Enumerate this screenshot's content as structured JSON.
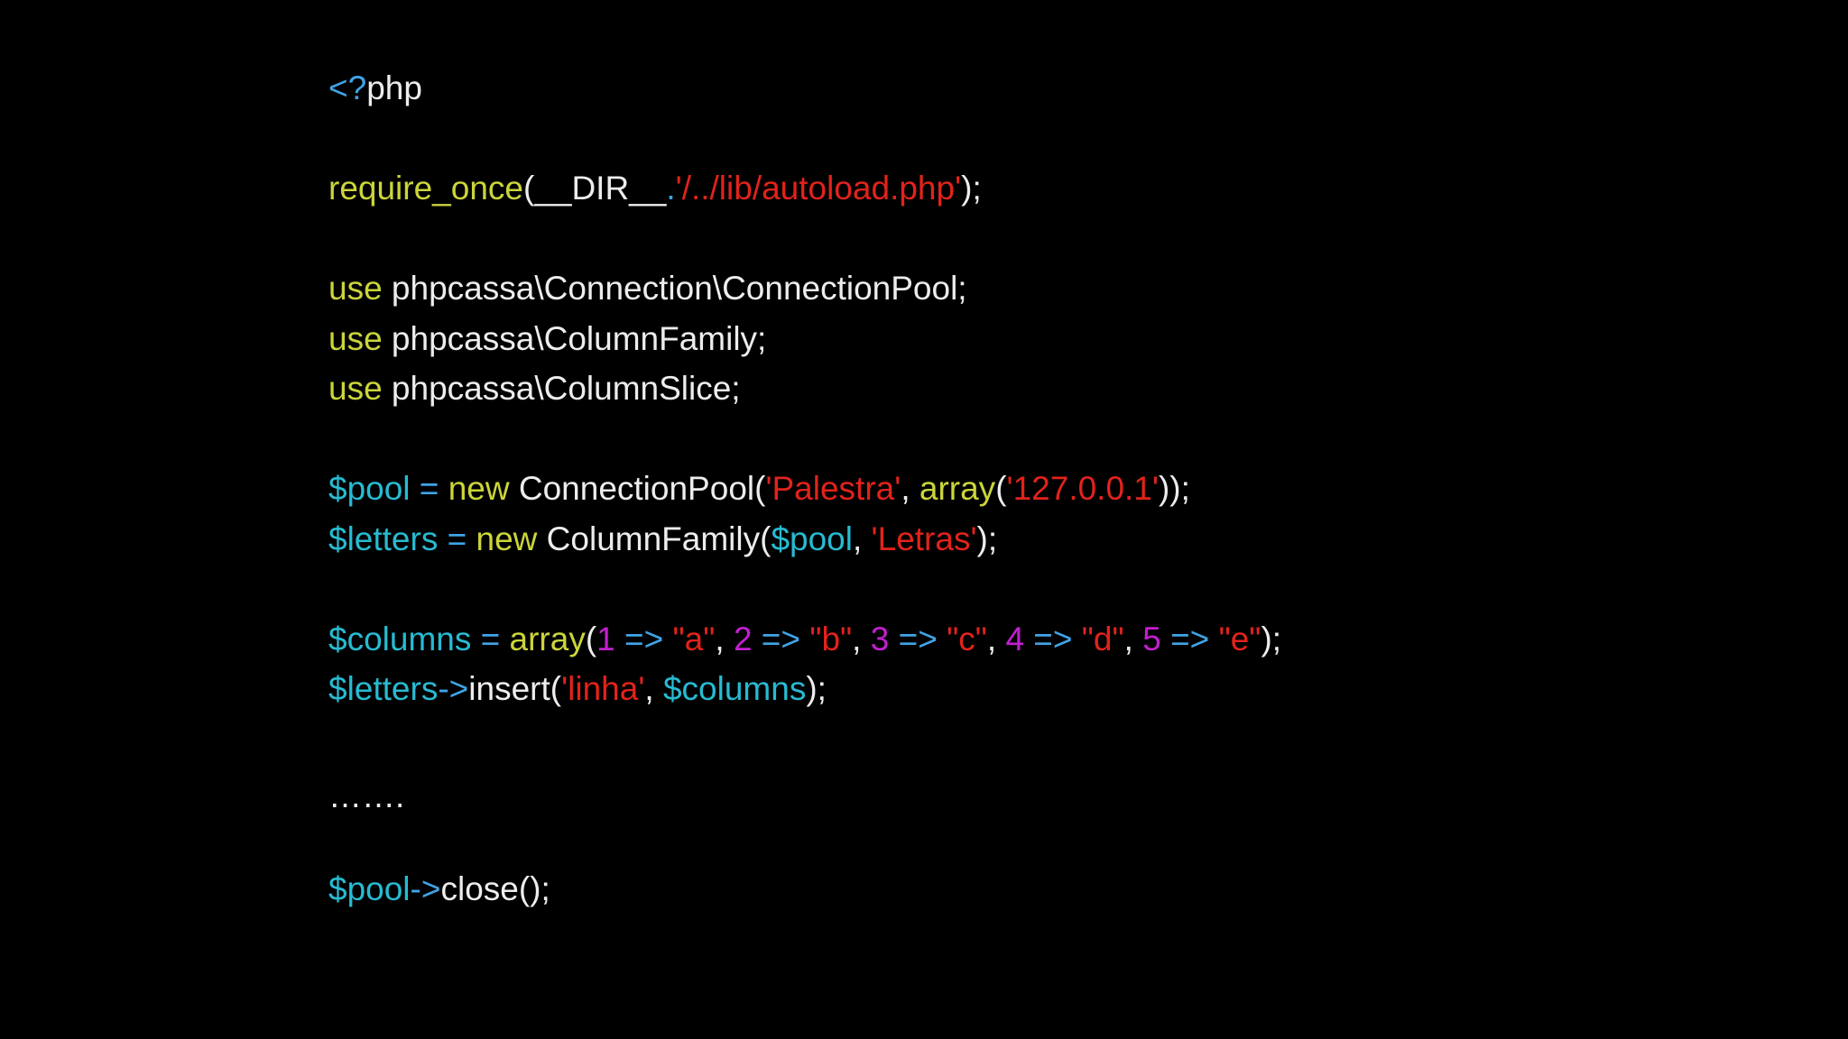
{
  "colors": {
    "background": "#000000",
    "plain": "#ededed",
    "keyword": "#cbd53a",
    "variable": "#27bbd2",
    "operator": "#3fa4e6",
    "string": "#e1231b",
    "number": "#c21fcf",
    "php_tag": "#3fa4e6"
  },
  "code": {
    "lines": [
      [
        {
          "text": "<?",
          "kind": "php_tag"
        },
        {
          "text": "php",
          "kind": "plain"
        }
      ],
      [],
      [
        {
          "text": "require_once",
          "kind": "keyword"
        },
        {
          "text": "(__DIR__",
          "kind": "plain"
        },
        {
          "text": ".",
          "kind": "operator"
        },
        {
          "text": "'/../lib/autoload.php'",
          "kind": "string"
        },
        {
          "text": ");",
          "kind": "plain"
        }
      ],
      [],
      [
        {
          "text": "use",
          "kind": "keyword"
        },
        {
          "text": " phpcassa\\Connection\\ConnectionPool;",
          "kind": "plain"
        }
      ],
      [
        {
          "text": "use",
          "kind": "keyword"
        },
        {
          "text": " phpcassa\\ColumnFamily;",
          "kind": "plain"
        }
      ],
      [
        {
          "text": "use",
          "kind": "keyword"
        },
        {
          "text": " phpcassa\\ColumnSlice;",
          "kind": "plain"
        }
      ],
      [],
      [
        {
          "text": "$pool",
          "kind": "variable"
        },
        {
          "text": " = ",
          "kind": "operator"
        },
        {
          "text": "new",
          "kind": "keyword"
        },
        {
          "text": " ConnectionPool(",
          "kind": "plain"
        },
        {
          "text": "'Palestra'",
          "kind": "string"
        },
        {
          "text": ", ",
          "kind": "plain"
        },
        {
          "text": "array",
          "kind": "keyword"
        },
        {
          "text": "(",
          "kind": "plain"
        },
        {
          "text": "'127.0.0.1'",
          "kind": "string"
        },
        {
          "text": "));",
          "kind": "plain"
        }
      ],
      [
        {
          "text": "$letters",
          "kind": "variable"
        },
        {
          "text": " = ",
          "kind": "operator"
        },
        {
          "text": "new",
          "kind": "keyword"
        },
        {
          "text": " ColumnFamily(",
          "kind": "plain"
        },
        {
          "text": "$pool",
          "kind": "variable"
        },
        {
          "text": ", ",
          "kind": "plain"
        },
        {
          "text": "'Letras'",
          "kind": "string"
        },
        {
          "text": ");",
          "kind": "plain"
        }
      ],
      [],
      [
        {
          "text": "$columns",
          "kind": "variable"
        },
        {
          "text": " = ",
          "kind": "operator"
        },
        {
          "text": "array",
          "kind": "keyword"
        },
        {
          "text": "(",
          "kind": "plain"
        },
        {
          "text": "1",
          "kind": "number"
        },
        {
          "text": " => ",
          "kind": "operator"
        },
        {
          "text": "\"a\"",
          "kind": "string"
        },
        {
          "text": ", ",
          "kind": "plain"
        },
        {
          "text": "2",
          "kind": "number"
        },
        {
          "text": " => ",
          "kind": "operator"
        },
        {
          "text": "\"b\"",
          "kind": "string"
        },
        {
          "text": ", ",
          "kind": "plain"
        },
        {
          "text": "3",
          "kind": "number"
        },
        {
          "text": " => ",
          "kind": "operator"
        },
        {
          "text": "\"c\"",
          "kind": "string"
        },
        {
          "text": ", ",
          "kind": "plain"
        },
        {
          "text": "4",
          "kind": "number"
        },
        {
          "text": " => ",
          "kind": "operator"
        },
        {
          "text": "\"d\"",
          "kind": "string"
        },
        {
          "text": ", ",
          "kind": "plain"
        },
        {
          "text": "5",
          "kind": "number"
        },
        {
          "text": " => ",
          "kind": "operator"
        },
        {
          "text": "\"e\"",
          "kind": "string"
        },
        {
          "text": ");",
          "kind": "plain"
        }
      ],
      [
        {
          "text": "$letters",
          "kind": "variable"
        },
        {
          "text": "->",
          "kind": "operator"
        },
        {
          "text": "insert(",
          "kind": "plain"
        },
        {
          "text": "'linha'",
          "kind": "string"
        },
        {
          "text": ", ",
          "kind": "plain"
        },
        {
          "text": "$columns",
          "kind": "variable"
        },
        {
          "text": ");",
          "kind": "plain"
        }
      ],
      [],
      [
        {
          "text": "…….",
          "kind": "plain"
        }
      ],
      [],
      [
        {
          "text": "$pool",
          "kind": "variable"
        },
        {
          "text": "->",
          "kind": "operator"
        },
        {
          "text": "close();",
          "kind": "plain"
        }
      ]
    ]
  }
}
